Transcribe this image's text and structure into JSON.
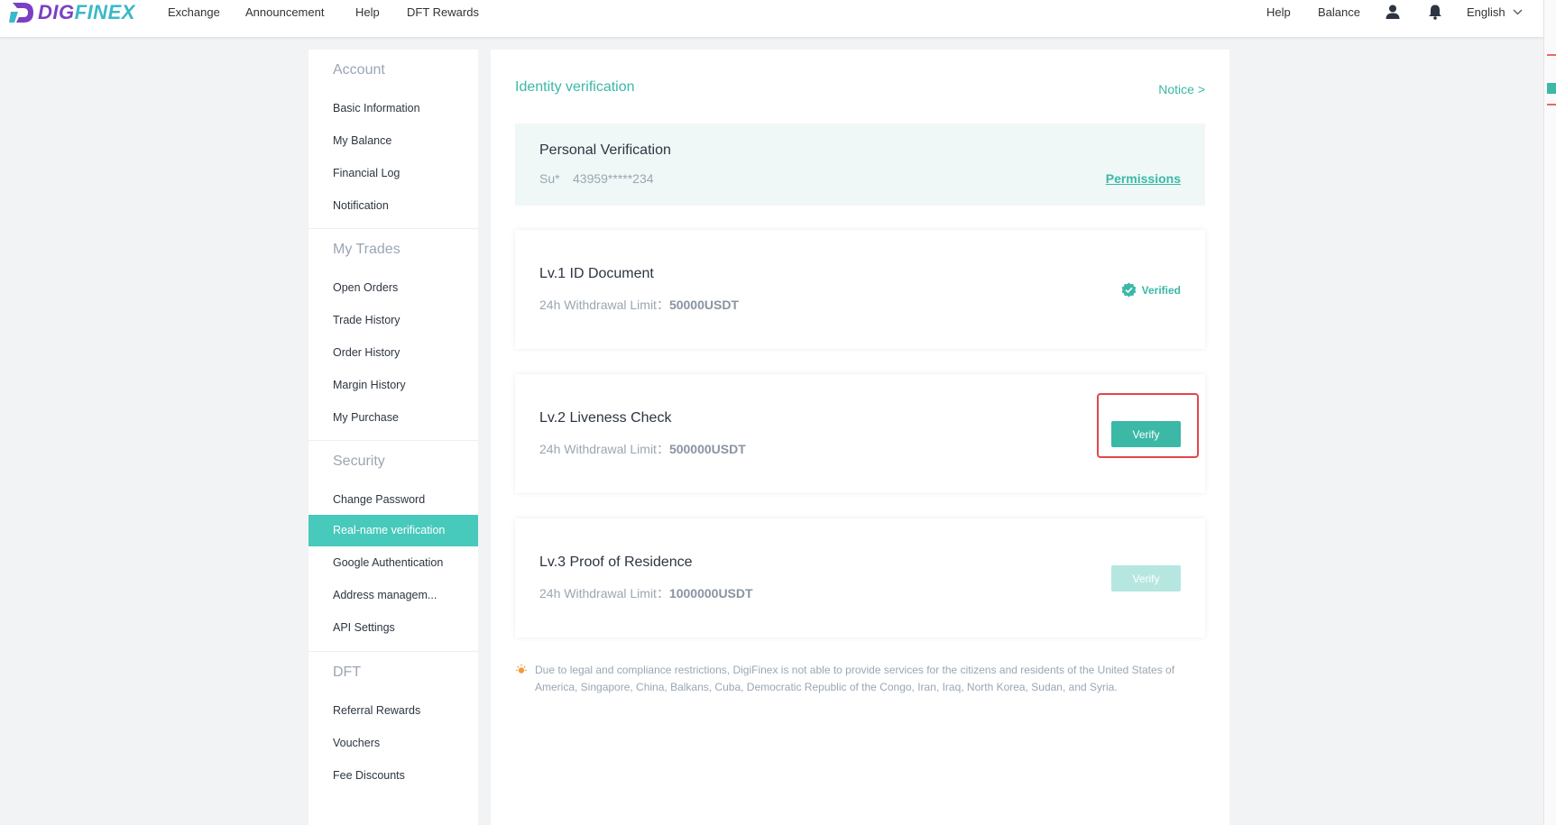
{
  "brand": {
    "part1": "DIG",
    "part2": "FINEX"
  },
  "nav": {
    "left": [
      "Exchange",
      "Announcement",
      "Help",
      "DFT Rewards"
    ],
    "right": {
      "help": "Help",
      "balance": "Balance",
      "language": "English"
    }
  },
  "sidebar": {
    "sections": [
      {
        "title": "Account",
        "items": [
          "Basic Information",
          "My Balance",
          "Financial Log",
          "Notification"
        ]
      },
      {
        "title": "My Trades",
        "items": [
          "Open Orders",
          "Trade History",
          "Order History",
          "Margin History",
          "My Purchase"
        ]
      },
      {
        "title": "Security",
        "items": [
          "Change Password",
          "Real-name verification",
          "Google Authentication",
          "Address managem...",
          "API Settings"
        ]
      },
      {
        "title": "DFT",
        "items": [
          "Referral Rewards",
          "Vouchers",
          "Fee Discounts"
        ]
      }
    ],
    "active_item": "Real-name verification"
  },
  "main": {
    "title": "Identity verification",
    "notice": "Notice >",
    "personal": {
      "title": "Personal Verification",
      "name": "Su*",
      "id": "43959*****234",
      "permissions": "Permissions"
    },
    "levels": [
      {
        "title": "Lv.1 ID Document",
        "limit_label": "24h Withdrawal Limit：",
        "limit_value": "50000USDT",
        "status": "Verified"
      },
      {
        "title": "Lv.2 Liveness Check",
        "limit_label": "24h Withdrawal Limit：",
        "limit_value": "500000USDT",
        "button": "Verify"
      },
      {
        "title": "Lv.3 Proof of Residence",
        "limit_label": "24h Withdrawal Limit：",
        "limit_value": "1000000USDT",
        "button": "Verify"
      }
    ],
    "disclaimer": "Due to legal and compliance restrictions, DigiFinex is not able to provide services for the citizens and residents of the United States of America, Singapore, China, Balkans, Cuba, Democratic Republic of the Congo, Iran, Iraq, North Korea, Sudan, and Syria."
  },
  "colors": {
    "accent": "#3bb8a6",
    "active_bg": "#47c9bb",
    "highlight": "#e0474c",
    "brand_purple": "#7b3fc4",
    "brand_teal": "#3bb8c9"
  }
}
